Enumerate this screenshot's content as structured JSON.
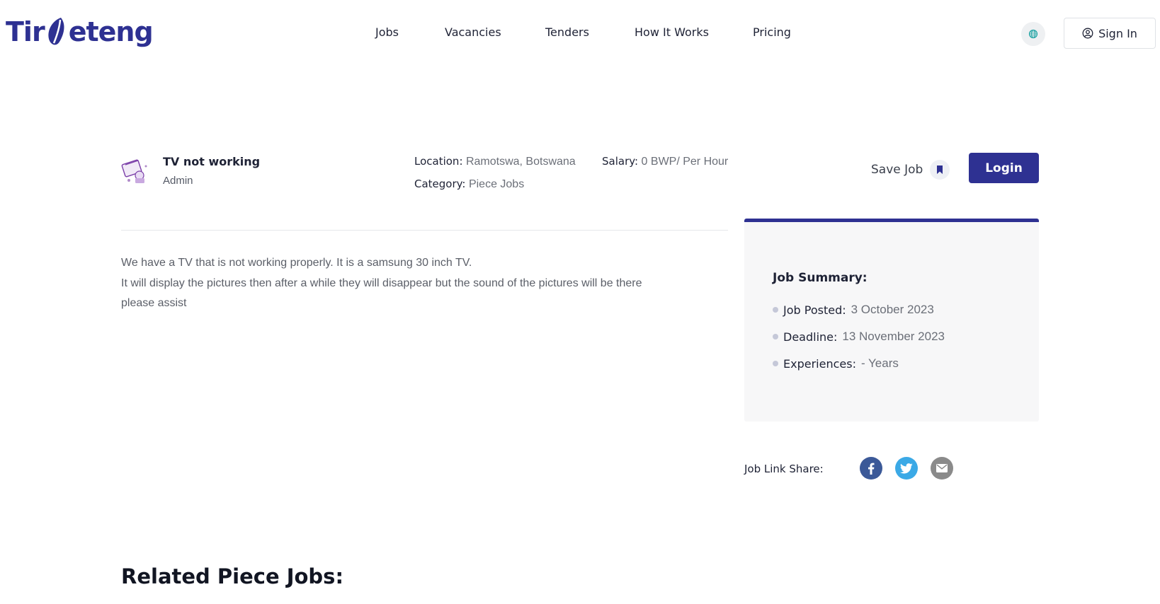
{
  "header": {
    "logo_text_left": "Tir",
    "logo_text_right": "eteng",
    "nav": [
      {
        "label": "Jobs"
      },
      {
        "label": "Vacancies"
      },
      {
        "label": "Tenders"
      },
      {
        "label": "How It Works"
      },
      {
        "label": "Pricing"
      }
    ],
    "sign_in_label": "Sign In",
    "icons": {
      "language": "globe-icon",
      "user": "user-circle-icon"
    }
  },
  "job": {
    "title": "TV not working",
    "company": "Admin",
    "location_label": "Location:",
    "location_value": "Ramotswa, Botswana",
    "salary_label": "Salary:",
    "salary_value": "0 BWP/ Per Hour",
    "category_label": "Category:",
    "category_value": "Piece Jobs",
    "save_label": "Save Job",
    "login_label": "Login",
    "description": [
      "We have a TV that is not working properly. It is a samsung 30 inch TV.",
      "It will display the pictures then after a while they will disappear but the sound of the pictures will be there",
      "please assist"
    ]
  },
  "summary": {
    "title": "Job Summary:",
    "items": [
      {
        "label": "Job Posted:",
        "value": "3 October 2023"
      },
      {
        "label": "Deadline:",
        "value": "13 November 2023"
      },
      {
        "label": "Experiences:",
        "value": "- Years"
      }
    ]
  },
  "share": {
    "label": "Job Link Share:",
    "icons": [
      "facebook-icon",
      "twitter-icon",
      "email-icon"
    ]
  },
  "related_title": "Related Piece Jobs:",
  "colors": {
    "brand": "#2e3192",
    "facebook": "#3b5998",
    "twitter": "#3ba9e6",
    "email": "#8a8a8a"
  }
}
